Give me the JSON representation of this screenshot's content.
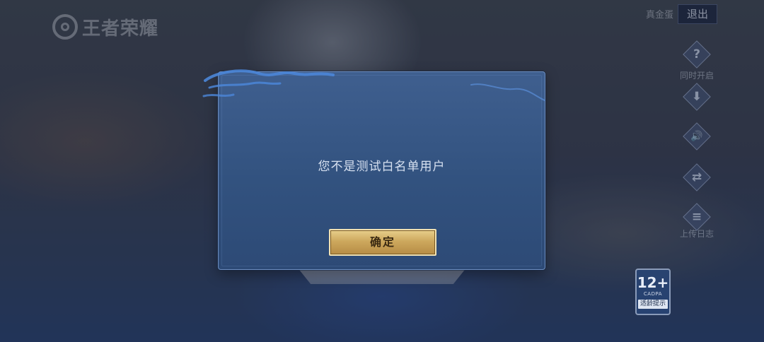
{
  "header": {
    "logo_text": "王者荣耀",
    "account_name": "真金蛋",
    "logout_label": "退出"
  },
  "side_panel": {
    "items": [
      {
        "icon": "question-icon",
        "glyph": "?",
        "label": "同时开启"
      },
      {
        "icon": "download-icon",
        "glyph": "⬇",
        "label": ""
      },
      {
        "icon": "speaker-icon",
        "glyph": "🔊",
        "label": ""
      },
      {
        "icon": "repair-icon",
        "glyph": "⇄",
        "label": ""
      },
      {
        "icon": "notice-icon",
        "glyph": "≡",
        "label": "上传日志"
      }
    ]
  },
  "age_rating": {
    "number": "12+",
    "org": "CADPA",
    "tip": "适龄提示"
  },
  "dialog": {
    "message": "您不是测试白名单用户",
    "confirm_label": "确定"
  },
  "colors": {
    "dialog_bg": "#35557f",
    "dialog_border": "#6c8dc0",
    "button_gold": "#cda85d"
  }
}
